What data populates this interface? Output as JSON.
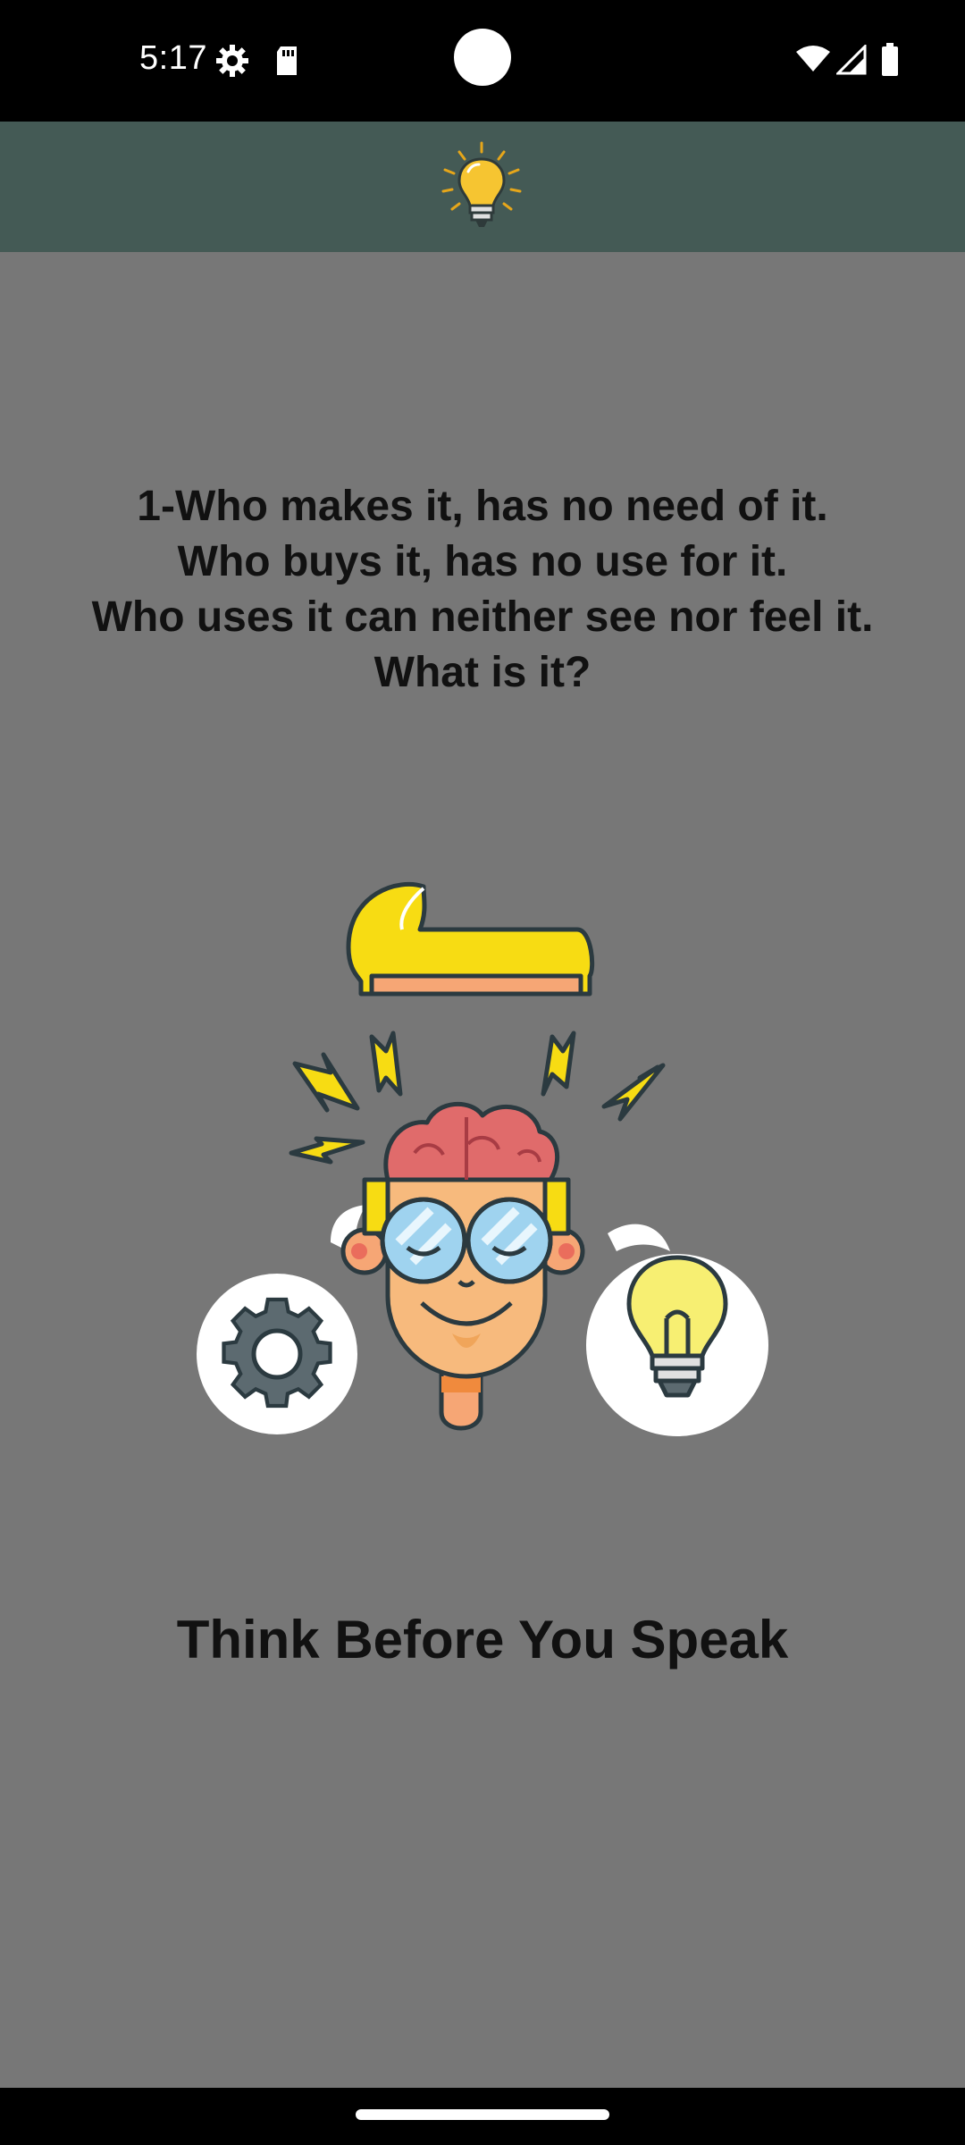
{
  "status_bar": {
    "time": "5:17",
    "icons_left": [
      "settings-gear-icon",
      "sd-card-icon"
    ],
    "icons_right": [
      "wifi-icon",
      "cellular-signal-icon",
      "battery-icon"
    ]
  },
  "app_bar": {
    "logo_icon": "lightbulb-logo-icon",
    "background_color": "#445a55"
  },
  "content": {
    "riddle_text": "1-Who makes it, has no need of it.\nWho buys it, has no use for it.\nWho uses it can neither see nor feel it.\nWhat is it?",
    "illustration": "thinking-boy-with-gear-and-lightbulb",
    "tagline": "Think Before You Speak"
  },
  "colors": {
    "page_background": "#777777",
    "text": "#111111"
  }
}
